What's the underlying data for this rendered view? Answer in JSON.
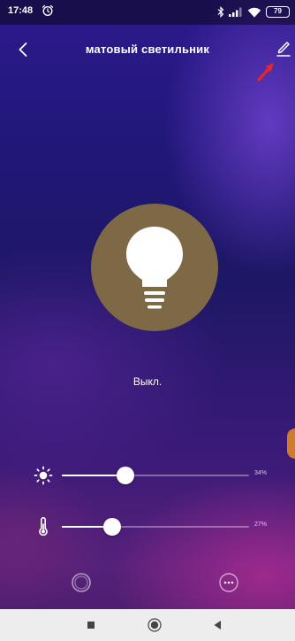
{
  "status_bar": {
    "time": "17:48",
    "battery": "79",
    "icons": [
      "alarm-clock-icon",
      "bluetooth-icon",
      "signal-icon",
      "wifi-icon",
      "battery-icon"
    ]
  },
  "header": {
    "title": "матовый светильник",
    "back_icon": "chevron-left-icon",
    "edit_icon": "pencil-icon"
  },
  "lamp": {
    "icon": "lightbulb-icon",
    "state": "Выкл.",
    "circle_color": "#7e6947"
  },
  "sliders": [
    {
      "name": "brightness",
      "icon": "sun-icon",
      "value": 34,
      "value_label": "34%"
    },
    {
      "name": "color-temperature",
      "icon": "thermometer-icon",
      "value": 27,
      "value_label": "27%"
    }
  ],
  "bottom_actions": [
    {
      "icon": "ring-icon"
    },
    {
      "icon": "more-dots-icon"
    }
  ],
  "nav_bar": {
    "icons": [
      "square-recents-icon",
      "circle-home-icon",
      "triangle-back-icon"
    ],
    "background": "#ededed"
  },
  "annotation": {
    "icon": "red-arrow-icon",
    "color": "#e8262a"
  }
}
